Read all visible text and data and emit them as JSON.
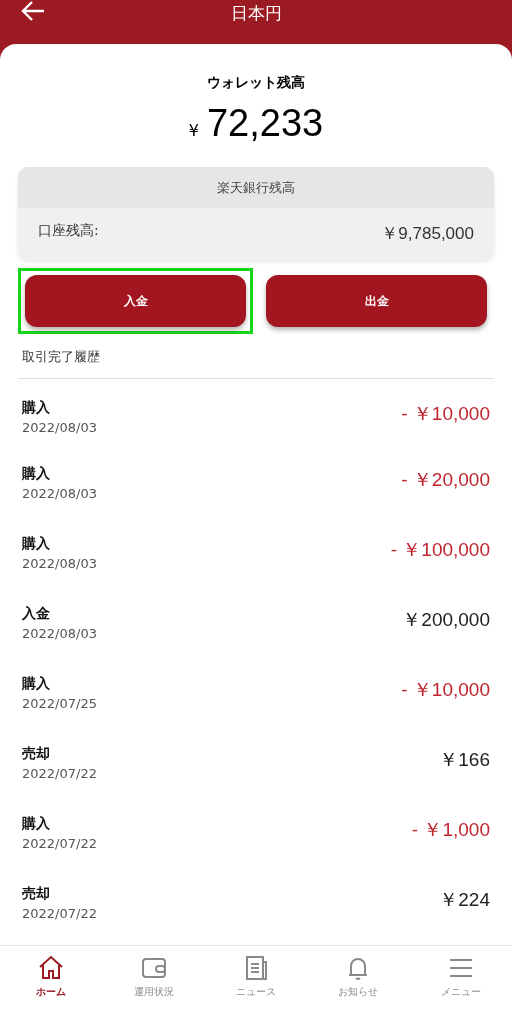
{
  "header": {
    "title": "日本円"
  },
  "wallet": {
    "label": "ウォレット残高",
    "currency": "¥",
    "amount": "72,233"
  },
  "bank": {
    "title": "楽天銀行残高",
    "label": "口座残高:",
    "amount": "￥9,785,000"
  },
  "buttons": [
    {
      "label": "入金",
      "highlighted": true
    },
    {
      "label": "出金",
      "highlighted": false
    }
  ],
  "history": {
    "title": "取引完了履歴",
    "rows": [
      {
        "type": "購入",
        "date": "2022/08/03",
        "amount": "- ￥10,000",
        "outgoing": true
      },
      {
        "type": "購入",
        "date": "2022/08/03",
        "amount": "- ￥20,000",
        "outgoing": true
      },
      {
        "type": "購入",
        "date": "2022/08/03",
        "amount": "- ￥100,000",
        "outgoing": true
      },
      {
        "type": "入金",
        "date": "2022/08/03",
        "amount": "￥200,000",
        "outgoing": false
      },
      {
        "type": "購入",
        "date": "2022/07/25",
        "amount": "- ￥10,000",
        "outgoing": true
      },
      {
        "type": "売却",
        "date": "2022/07/22",
        "amount": "￥166",
        "outgoing": false
      },
      {
        "type": "購入",
        "date": "2022/07/22",
        "amount": "- ￥1,000",
        "outgoing": true
      },
      {
        "type": "売却",
        "date": "2022/07/22",
        "amount": "￥224",
        "outgoing": false
      }
    ]
  },
  "tabbar": [
    {
      "kind": "home",
      "label": "ホーム",
      "selected": true
    },
    {
      "kind": "wallet",
      "label": "運用状況",
      "selected": false
    },
    {
      "kind": "news",
      "label": "ニュース",
      "selected": false
    },
    {
      "kind": "bell",
      "label": "お知らせ",
      "selected": false
    },
    {
      "kind": "menu",
      "label": "メニュー",
      "selected": false
    }
  ]
}
